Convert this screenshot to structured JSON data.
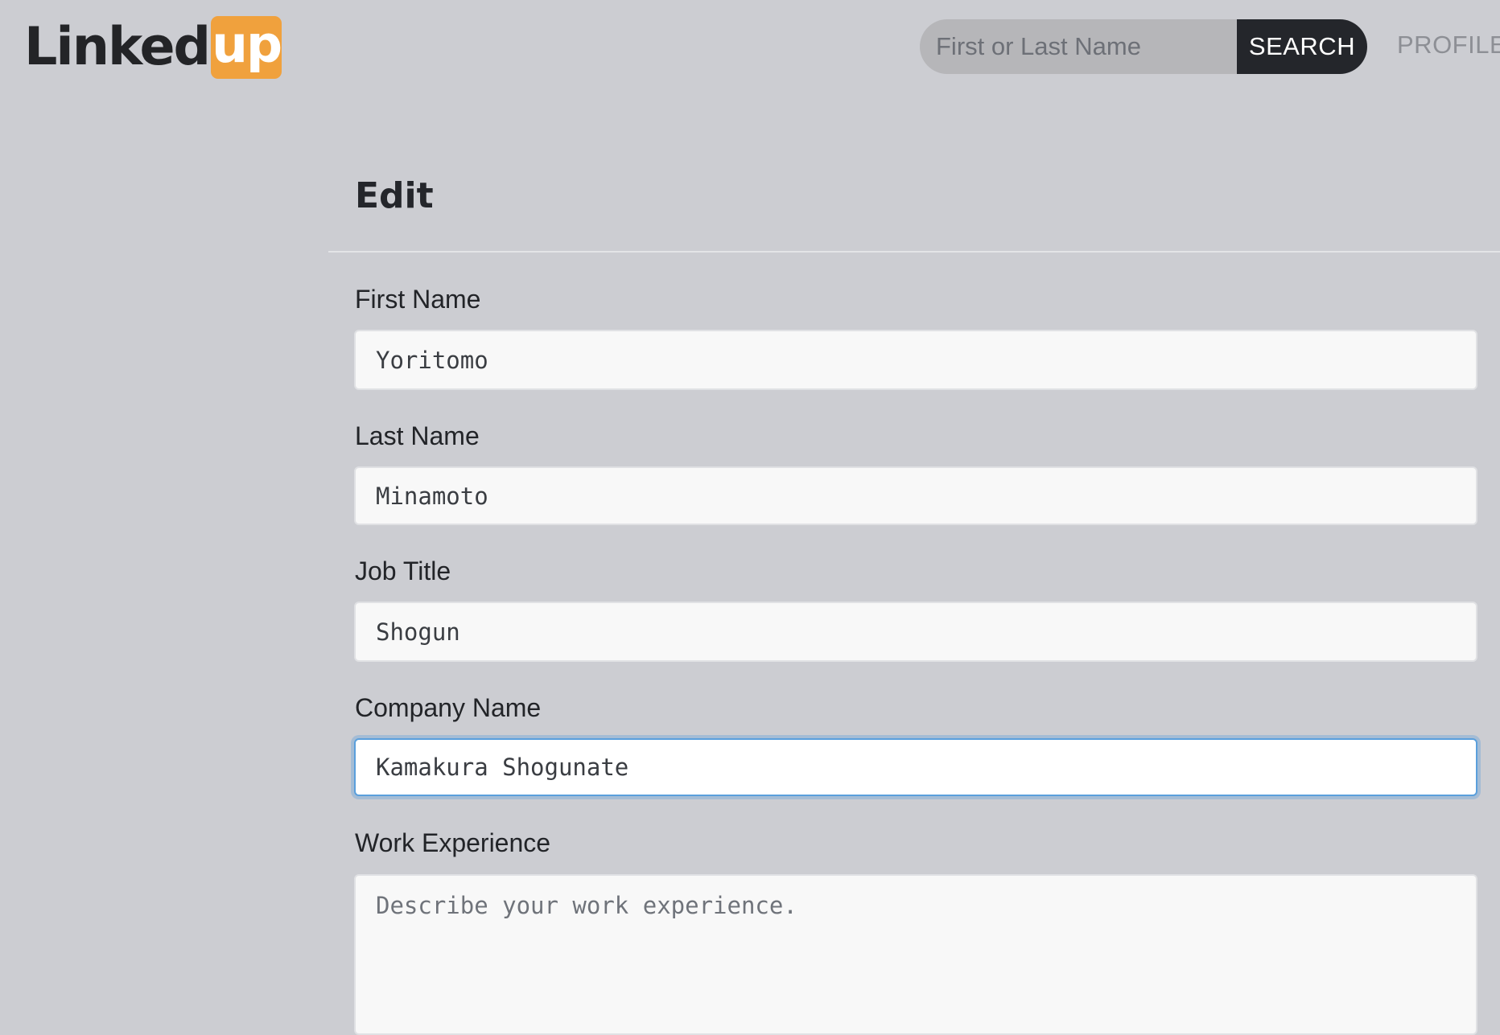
{
  "header": {
    "logo_text": "Linked",
    "logo_highlight": "up",
    "search": {
      "placeholder": "First or Last Name",
      "button_label": "SEARCH"
    },
    "nav": {
      "profile_label": "PROFILE"
    }
  },
  "main": {
    "title": "Edit",
    "fields": {
      "first_name": {
        "label": "First Name",
        "value": "Yoritomo"
      },
      "last_name": {
        "label": "Last Name",
        "value": "Minamoto"
      },
      "job_title": {
        "label": "Job Title",
        "value": "Shogun"
      },
      "company_name": {
        "label": "Company Name",
        "value": "Kamakura Shogunate"
      },
      "work_experience": {
        "label": "Work Experience",
        "value": "",
        "placeholder": "Describe your work experience."
      }
    }
  },
  "colors": {
    "background": "#cccdd2",
    "brand_accent": "#f0a13d",
    "search_button": "#24262b",
    "focus_ring": "#5a9fdc"
  }
}
